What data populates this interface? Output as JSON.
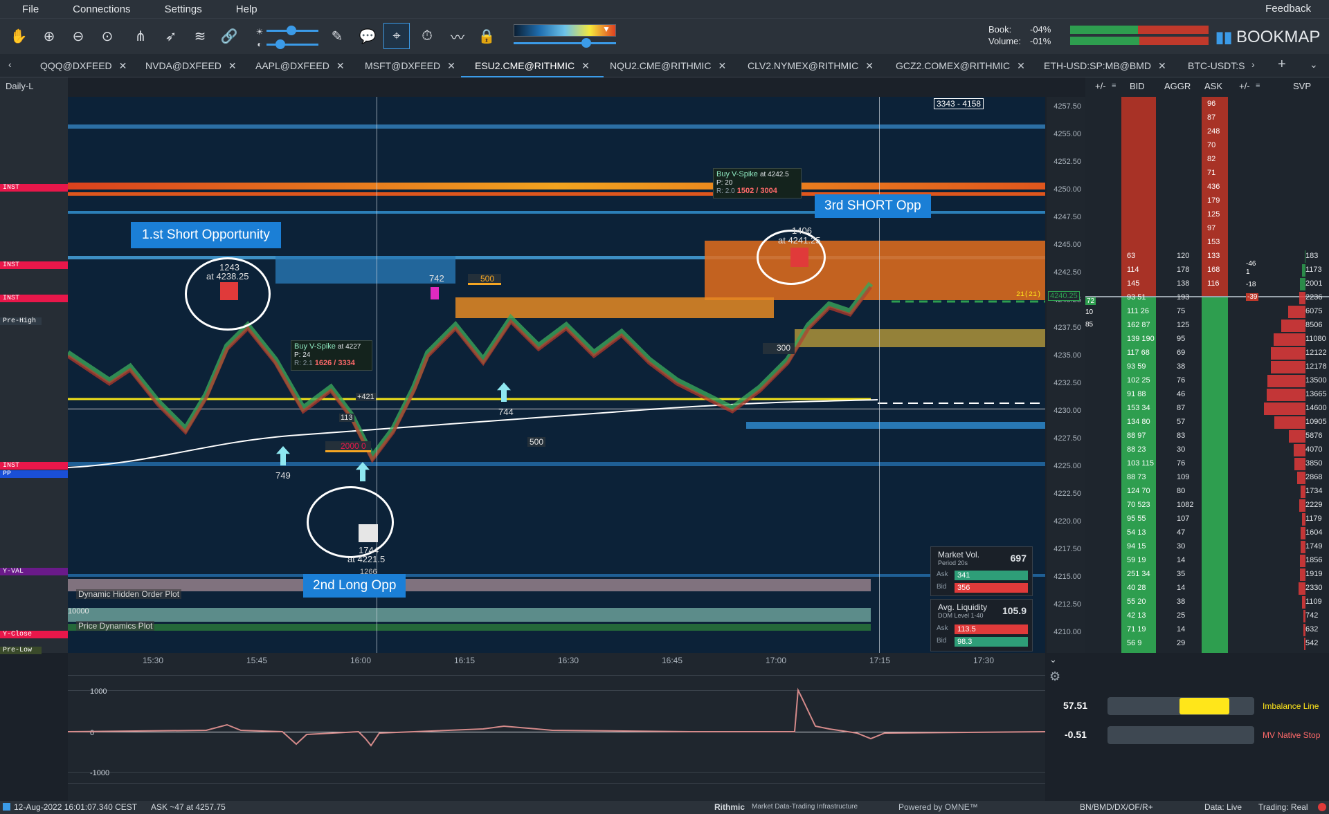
{
  "menu": {
    "file": "File",
    "connections": "Connections",
    "settings": "Settings",
    "help": "Help",
    "feedback": "Feedback"
  },
  "stats": {
    "book_label": "Book:",
    "book_value": "-04%",
    "volume_label": "Volume:",
    "volume_value": "-01%"
  },
  "brand": {
    "logo_text": "BOOKMAP"
  },
  "tabs": [
    "QQQ@DXFEED",
    "NVDA@DXFEED",
    "AAPL@DXFEED",
    "MSFT@DXFEED",
    "ESU2.CME@RITHMIC",
    "NQU2.CME@RITHMIC",
    "CLV2.NYMEX@RITHMIC",
    "GCZ2.COMEX@RITHMIC",
    "ETH-USD:SP:MB@BMD",
    "BTC-USDT:S"
  ],
  "active_tab": "ESU2.CME@RITHMIC",
  "chart": {
    "timeframe_label": "Daily-L",
    "range_box": "3343 - 4158",
    "last_price": "4240.25",
    "last_marker": "21(21)"
  },
  "left_labels": [
    "INST",
    "INST",
    "INST",
    "Pre-High",
    "INST",
    "PP",
    "Y-VAL",
    "Y-Close",
    "Pre-Low"
  ],
  "price_axis": [
    "4257.50",
    "4255.00",
    "4252.50",
    "4250.00",
    "4247.50",
    "4245.00",
    "4242.50",
    "4240.25",
    "4237.50",
    "4235.00",
    "4232.50",
    "4230.00",
    "4227.50",
    "4225.00",
    "4222.50",
    "4220.00",
    "4217.50",
    "4215.00",
    "4212.50",
    "4210.00"
  ],
  "time_axis": [
    "15:30",
    "15:45",
    "16:00",
    "16:15",
    "16:30",
    "16:45",
    "17:00",
    "17:15",
    "17:30"
  ],
  "dom_headers": {
    "plusminus_left": "+/-",
    "bid": "BID",
    "aggr": "AGGR",
    "ask": "ASK",
    "plusminus_right": "+/-",
    "svp": "SVP"
  },
  "dom_rows": [
    {
      "bid": "",
      "aggr": "",
      "ask": "96",
      "svp": ""
    },
    {
      "bid": "",
      "aggr": "",
      "ask": "87",
      "svp": ""
    },
    {
      "bid": "",
      "aggr": "",
      "ask": "248",
      "svp": ""
    },
    {
      "bid": "",
      "aggr": "",
      "ask": "70",
      "svp": ""
    },
    {
      "bid": "",
      "aggr": "",
      "ask": "82",
      "svp": ""
    },
    {
      "bid": "",
      "aggr": "",
      "ask": "71",
      "svp": ""
    },
    {
      "bid": "",
      "aggr": "",
      "ask": "436",
      "svp": ""
    },
    {
      "bid": "",
      "aggr": "",
      "ask": "179",
      "svp": ""
    },
    {
      "bid": "",
      "aggr": "",
      "ask": "125",
      "svp": ""
    },
    {
      "bid": "",
      "aggr": "",
      "ask": "97",
      "svp": ""
    },
    {
      "bid": "",
      "aggr": "",
      "ask": "153",
      "svp": ""
    },
    {
      "bid": "63",
      "aggr": "120",
      "ask": "133",
      "svp": "183"
    },
    {
      "bid": "114",
      "aggr": "178",
      "ask": "168",
      "svp": "1173"
    },
    {
      "bid": "145",
      "aggr": "138",
      "ask": "116",
      "svp": "2001"
    },
    {
      "bid": "93 51",
      "aggr": "193",
      "ask": "",
      "svp": "2236"
    },
    {
      "bid": "111 26",
      "aggr": "75",
      "ask": "",
      "svp": "6075"
    },
    {
      "bid": "162 87",
      "aggr": "125",
      "ask": "",
      "svp": "8506"
    },
    {
      "bid": "139 190",
      "aggr": "95",
      "ask": "",
      "svp": "11080"
    },
    {
      "bid": "117 68",
      "aggr": "69",
      "ask": "",
      "svp": "12122"
    },
    {
      "bid": "93 59",
      "aggr": "38",
      "ask": "",
      "svp": "12178"
    },
    {
      "bid": "102 25",
      "aggr": "76",
      "ask": "",
      "svp": "13500"
    },
    {
      "bid": "91 88",
      "aggr": "46",
      "ask": "",
      "svp": "13665"
    },
    {
      "bid": "153 34",
      "aggr": "87",
      "ask": "",
      "svp": "14600"
    },
    {
      "bid": "134 80",
      "aggr": "57",
      "ask": "",
      "svp": "10905"
    },
    {
      "bid": "88 97",
      "aggr": "83",
      "ask": "",
      "svp": "5876"
    },
    {
      "bid": "88 23",
      "aggr": "30",
      "ask": "",
      "svp": "4070"
    },
    {
      "bid": "103 115",
      "aggr": "76",
      "ask": "",
      "svp": "3850"
    },
    {
      "bid": "88 73",
      "aggr": "109",
      "ask": "",
      "svp": "2868"
    },
    {
      "bid": "124 70",
      "aggr": "80",
      "ask": "",
      "svp": "1734"
    },
    {
      "bid": "70 523",
      "aggr": "1082",
      "ask": "",
      "svp": "2229"
    },
    {
      "bid": "95 55",
      "aggr": "107",
      "ask": "",
      "svp": "1179"
    },
    {
      "bid": "54 13",
      "aggr": "47",
      "ask": "",
      "svp": "1604"
    },
    {
      "bid": "94 15",
      "aggr": "30",
      "ask": "",
      "svp": "1749"
    },
    {
      "bid": "59 19",
      "aggr": "14",
      "ask": "",
      "svp": "1856"
    },
    {
      "bid": "251 34",
      "aggr": "35",
      "ask": "",
      "svp": "1919"
    },
    {
      "bid": "40 28",
      "aggr": "14",
      "ask": "",
      "svp": "2330"
    },
    {
      "bid": "55 20",
      "aggr": "38",
      "ask": "",
      "svp": "1109"
    },
    {
      "bid": "42 13",
      "aggr": "25",
      "ask": "",
      "svp": "742"
    },
    {
      "bid": "71 19",
      "aggr": "14",
      "ask": "",
      "svp": "632"
    },
    {
      "bid": "56 9",
      "aggr": "29",
      "ask": "",
      "svp": "542"
    }
  ],
  "dom_extra": {
    "left_mark_1": "72",
    "left_mark_2": "10",
    "left_mark_3": "85",
    "right_mark_1": "-46",
    "right_mark_2": "1",
    "right_mark_3": "-18",
    "right_mark_4": "-39"
  },
  "annotations": {
    "first_short": "1.st Short Opportunity",
    "second_long": "2nd Long Opp",
    "third_short": "3rd SHORT Opp",
    "e1_count": "1243",
    "e1_at": "at 4238.25",
    "e2_count": "1744",
    "e2_at": "at 4221.5",
    "e2_extra": "1266",
    "e3_count": "1406",
    "e3_at": "at 4241.25",
    "vol_742": "742",
    "vol_749": "749",
    "vol_744": "744",
    "vol_500a": "500",
    "vol_500b": "500",
    "vol_2000": "2000",
    "vol_0": "0",
    "vol_300": "300",
    "vol_421": "+421",
    "vol_1131": "113"
  },
  "spike1": {
    "title": "Buy V-Spike",
    "at": "at 4227",
    "p": "P: 24",
    "r": "R: 2.1",
    "ratio": "1626 / 3334"
  },
  "spike2": {
    "title": "Buy V-Spike",
    "at": "at 4242.5",
    "p": "P: 20",
    "r": "R: 2.0",
    "ratio": "1502 / 3004"
  },
  "market_vol": {
    "title": "Market Vol.",
    "period": "Period 20s",
    "value": "697",
    "ask_label": "Ask",
    "ask": "341",
    "bid_label": "Bid",
    "bid": "356",
    "ask_frac": 0.49,
    "bid_frac": 0.51
  },
  "avg_liq": {
    "title": "Avg. Liquidity",
    "sub": "DOM Level 1-40",
    "value": "105.9",
    "ask_label": "Ask",
    "ask": "113.5",
    "bid_label": "Bid",
    "bid": "98.3",
    "ask_frac": 0.54,
    "bid_frac": 0.46
  },
  "plots": {
    "hidden_order": "Dynamic Hidden Order Plot",
    "hidden_value": "10000",
    "price_dynamics": "Price Dynamics Plot"
  },
  "oscillator": {
    "ticks": [
      "1000",
      "0",
      "-1000"
    ]
  },
  "controls": {
    "imbalance_value": "57.51",
    "imbalance_label": "Imbalance Line",
    "mv_value": "-0.51",
    "mv_label": "MV Native Stop",
    "imbalance_frac": 0.58
  },
  "status": {
    "left": "12-Aug-2022 16:01:07.340 CEST",
    "ask": "ASK ~47 at 4257.75",
    "rithmic": "Rithmic",
    "rithmic_tag": "Market Data-Trading Infrastructure",
    "omne": "Powered by OMNE™",
    "feed": "BN/BMD/DX/OF/R+",
    "data": "Data: Live",
    "trading": "Trading: Real"
  },
  "colors": {
    "accent": "#3b9be8",
    "bid_green": "#2e9e4f",
    "ask_red": "#c0392b",
    "inst": "#e8174a",
    "pp": "#1a4fd6",
    "yval": "#6a1a8a",
    "imbalance": "#ffe61a"
  }
}
